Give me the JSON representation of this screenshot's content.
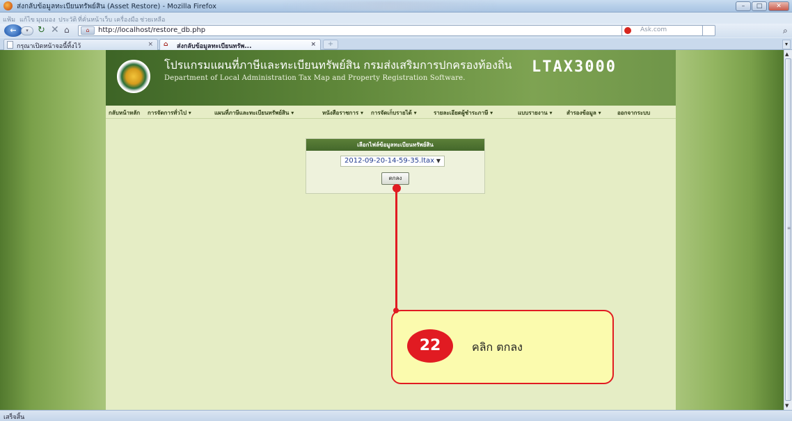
{
  "window": {
    "title": "ส่งกลับข้อมูลทะเบียนทรัพย์สิน (Asset Restore) - Mozilla Firefox",
    "controls": {
      "minimize": "–",
      "maximize": "□",
      "close": "✕"
    }
  },
  "menu": [
    "แฟ้ม",
    "แก้ไข",
    "มุมมอง",
    "ประวัติ",
    "ที่คั่นหน้าเว็บ",
    "เครื่องมือ",
    "ช่วยเหลือ"
  ],
  "nav": {
    "url": "http://localhost/restore_db.php",
    "search_placeholder": "Ask.com"
  },
  "tabs": [
    {
      "label": "กรุณาเปิดหน้าจอนี้ทิ้งไว้",
      "close": "×"
    },
    {
      "label": "ส่งกลับข้อมูลทะเบียนทรัพ...",
      "close": "×"
    }
  ],
  "newtab_label": "+",
  "banner": {
    "th_title": "โปรแกรมแผนที่ภาษีและทะเบียนทรัพย์สิน กรมส่งเสริมการปกครองท้องถิ่น",
    "en_title": "Department of Local Administration Tax Map and Property Registration Software.",
    "logo_text": "LTAX3000"
  },
  "site_menu": [
    "กลับหน้าหลัก",
    "การจัดการทั่วไป ▾",
    "แผนที่ภาษีและทะเบียนทรัพย์สิน ▾",
    "หนังสือราชการ ▾",
    "การจัดเก็บรายได้ ▾",
    "รายละเอียดผู้ชำระภาษี ▾",
    "แบบรายงาน ▾",
    "สำรองข้อมูล ▾",
    "ออกจากระบบ"
  ],
  "form": {
    "header": "เลือกไฟล์ข้อมูลทะเบียนทรัพย์สิน",
    "selected_file": "2012-09-20-14-59-35.ltax",
    "ok_label": "ตกลง"
  },
  "callout": {
    "step": "22",
    "text": "คลิก  ตกลง"
  },
  "status": "เสร็จสิ้น",
  "colors": {
    "accent_red": "#e11b22",
    "callout_bg": "#fbfbae",
    "banner_green": "#5e8639"
  }
}
